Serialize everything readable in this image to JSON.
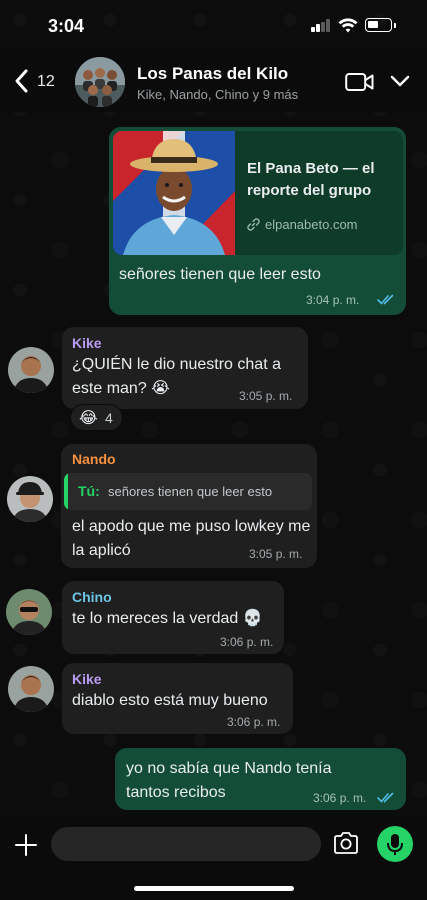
{
  "status": {
    "time": "3:04"
  },
  "header": {
    "back_count": "12",
    "group_name": "Los Panas del Kilo",
    "members": "Kike, Nando, Chino y 9 más"
  },
  "messages": [
    {
      "type": "outgoing",
      "link_title": "El Pana Beto — el reporte del grupo",
      "link_domain": "elpanabeto.com",
      "text": "señores tienen que leer esto",
      "time": "3:04 p. m."
    },
    {
      "type": "incoming",
      "sender": "Kike",
      "sender_color": "#b99cf2",
      "text": "¿QUIÉN le dio nuestro chat a este man? 😭",
      "time": "3:05 p. m.",
      "reaction_emoji": "😂",
      "reaction_count": "4"
    },
    {
      "type": "incoming",
      "sender": "Nando",
      "sender_color": "#f7913d",
      "quote_sender": "Tú:",
      "quote_text": "señores tienen que leer esto",
      "text": "el apodo que me puso lowkey me la aplicó",
      "time": "3:05 p. m."
    },
    {
      "type": "incoming",
      "sender": "Chino",
      "sender_color": "#6cc5e6",
      "text": "te lo mereces la verdad 💀",
      "time": "3:06 p. m."
    },
    {
      "type": "incoming",
      "sender": "Kike",
      "sender_color": "#b99cf2",
      "text": "diablo esto está muy bueno",
      "time": "3:06 p. m."
    },
    {
      "type": "outgoing",
      "text": "yo no sabía que Nando tenía tantos recibos",
      "time": "3:06 p. m."
    }
  ],
  "composer": {
    "placeholder": ""
  },
  "colors": {
    "outgoing_bubble": "#134d37",
    "incoming_bubble": "#1f1f1f",
    "accent": "#25d366",
    "read_ticks": "#53bdeb"
  },
  "icons": [
    "back-chevron-icon",
    "video-call-icon",
    "chevron-down-icon",
    "link-icon",
    "double-check-icon",
    "plus-icon",
    "camera-icon",
    "microphone-icon"
  ]
}
